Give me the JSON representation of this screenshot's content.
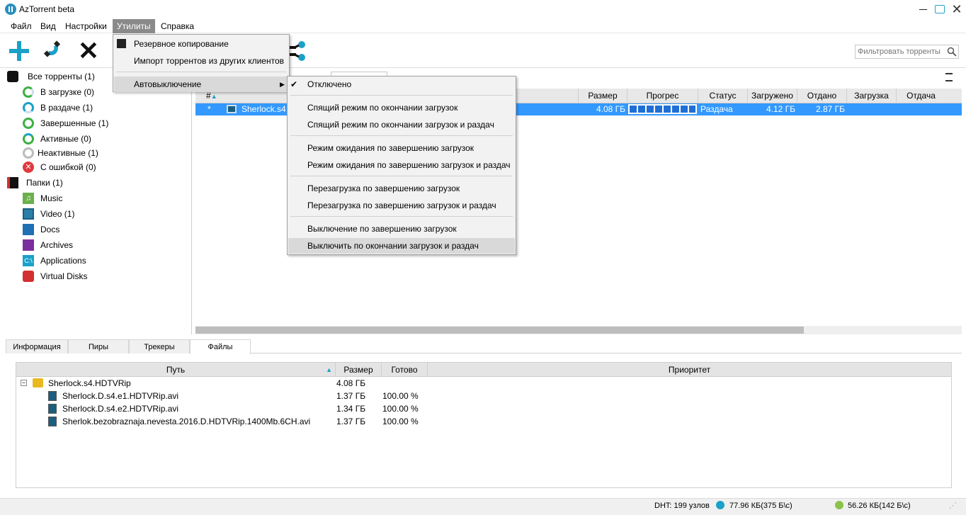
{
  "window": {
    "title": "AzTorrent beta"
  },
  "menubar": {
    "file": "Файл",
    "view": "Вид",
    "settings": "Настройки",
    "utils": "Утилиты",
    "help": "Справка"
  },
  "toolbar": {
    "search_placeholder": "Фильтровать торренты"
  },
  "sidebar": {
    "all": "Все торренты (1)",
    "downloading": "В загрузке (0)",
    "seeding": "В раздаче (1)",
    "completed": "Завершенные (1)",
    "active": "Активные (0)",
    "inactive": "Неактивные (1)",
    "error": "С ошибкой (0)",
    "folders": "Папки (1)",
    "music": "Music",
    "video": "Video (1)",
    "docs": "Docs",
    "archives": "Archives",
    "applications": "Applications",
    "virtual_disks": "Virtual Disks"
  },
  "list": {
    "headers": {
      "num": "#",
      "size": "Размер",
      "progress": "Прогрес",
      "status": "Статус",
      "downloaded": "Загружено",
      "uploaded": "Отдано",
      "down_speed": "Загрузка",
      "up_speed": "Отдача"
    },
    "row": {
      "num": "*",
      "name": "Sherlock.s4.",
      "size": "4.08 ГБ",
      "progress": 1.0,
      "status": "Раздача",
      "downloaded": "4.12 ГБ",
      "uploaded": "2.87 ГБ"
    }
  },
  "tabs": {
    "info": "Информация",
    "peers": "Пиры",
    "trackers": "Трекеры",
    "files": "Файлы"
  },
  "files": {
    "headers": {
      "path": "Путь",
      "size": "Размер",
      "done": "Готово",
      "priority": "Приоритет"
    },
    "folder": {
      "name": "Sherlock.s4.HDTVRip",
      "size": "4.08 ГБ"
    },
    "items": [
      {
        "name": "Sherlock.D.s4.e1.HDTVRip.avi",
        "size": "1.37 ГБ",
        "done": "100.00 %"
      },
      {
        "name": "Sherlock.D.s4.e2.HDTVRip.avi",
        "size": "1.34 ГБ",
        "done": "100.00 %"
      },
      {
        "name": "Sherlok.bezobraznaja.nevesta.2016.D.HDTVRip.1400Mb.6CH.avi",
        "size": "1.37 ГБ",
        "done": "100.00 %"
      }
    ]
  },
  "status": {
    "dht": "DHT: 199 узлов",
    "down": "77.96 КБ(375 Б\\с)",
    "up": "56.26 КБ(142 Б\\с)"
  },
  "utils_menu": {
    "backup": "Резервное копирование",
    "import": "Импорт торрентов из других клиентов",
    "autoshutdown": "Автовыключение"
  },
  "autoshutdown_menu": {
    "off": "Отключено",
    "sleep_dl": "Спящий режим по окончании загрузок",
    "sleep_dl_seed": "Спящий режим  по окончании загрузок и раздач",
    "standby_dl": "Режим ожидания по завершению загрузок",
    "standby_dl_seed": "Режим ожидания по завершению загрузок и раздач",
    "reboot_dl": "Перезагрузка по завершению загрузок",
    "reboot_dl_seed": "Перезагрузка по завершению загрузок и раздач",
    "shutdown_dl": "Выключение по завершению загрузок",
    "shutdown_dl_seed": "Выключить по окончании загрузок и раздач"
  },
  "colors": {
    "accent": "#1ba1c8",
    "selection": "#3399ff",
    "seed_green": "#3cb043",
    "error_red": "#e0393e"
  }
}
